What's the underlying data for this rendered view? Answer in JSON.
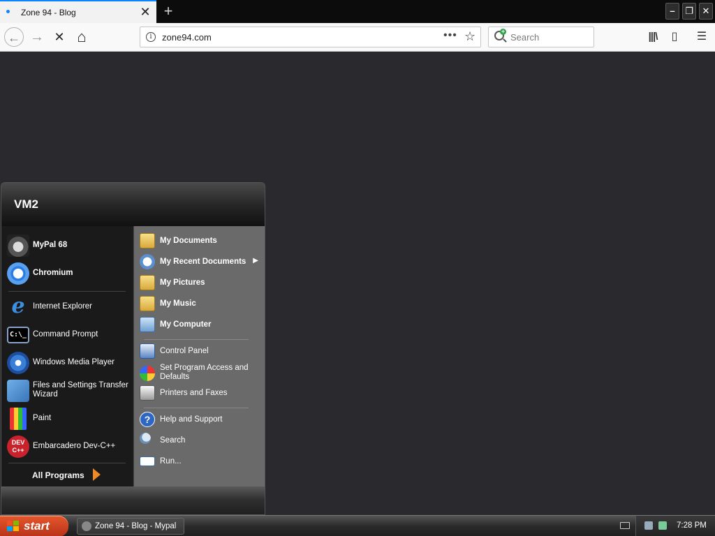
{
  "browser": {
    "tab_title": "Zone 94 - Blog",
    "tab_close": "✕",
    "new_tab": "+",
    "url": "zone94.com",
    "search_placeholder": "Search",
    "buttons": {
      "back": "←",
      "forward": "→",
      "stop": "✕",
      "home": "⌂",
      "page_actions": "•••",
      "bookmark": "☆",
      "library": "|||\\",
      "sidebar": "▯",
      "menu": "☰"
    },
    "window_controls": {
      "minimize": "–",
      "restore": "❐",
      "close": "✕"
    }
  },
  "start_menu": {
    "user": "VM2",
    "pinned": [
      {
        "label": "MyPal 68",
        "icon": "mypal-icon"
      },
      {
        "label": "Chromium",
        "icon": "chromium-icon"
      }
    ],
    "recent": [
      {
        "label": "Internet Explorer",
        "icon": "internet-explorer-icon"
      },
      {
        "label": "Command Prompt",
        "icon": "command-prompt-icon",
        "icon_text": "C:\\_"
      },
      {
        "label": "Windows Media Player",
        "icon": "media-player-icon"
      },
      {
        "label": "Files and Settings Transfer Wizard",
        "icon": "transfer-wizard-icon"
      },
      {
        "label": "Paint",
        "icon": "paint-icon"
      },
      {
        "label": "Embarcadero Dev-C++",
        "icon": "devcpp-icon",
        "icon_text": "DEV C++"
      }
    ],
    "all_programs": "All Programs",
    "places": [
      {
        "label": "My Documents",
        "icon": "my-documents-icon"
      },
      {
        "label": "My Recent Documents",
        "icon": "recent-documents-icon",
        "arrow": "▶"
      },
      {
        "label": "My Pictures",
        "icon": "my-pictures-icon"
      },
      {
        "label": "My Music",
        "icon": "my-music-icon"
      },
      {
        "label": "My Computer",
        "icon": "my-computer-icon"
      }
    ],
    "settings": [
      {
        "label": "Control Panel",
        "icon": "control-panel-icon"
      },
      {
        "label": "Set Program Access and Defaults",
        "icon": "program-defaults-icon"
      },
      {
        "label": "Printers and Faxes",
        "icon": "printer-icon"
      }
    ],
    "help": [
      {
        "label": "Help and Support",
        "icon": "help-icon",
        "icon_text": "?"
      },
      {
        "label": "Search",
        "icon": "search-icon"
      },
      {
        "label": "Run...",
        "icon": "run-icon"
      }
    ]
  },
  "taskbar": {
    "start_label": "start",
    "task_label": "Zone 94 - Blog - Mypal",
    "clock": "7:28 PM"
  }
}
